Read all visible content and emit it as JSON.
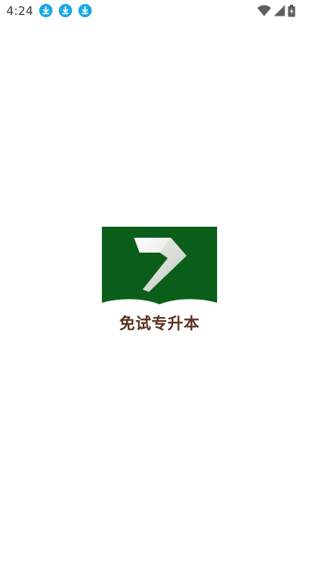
{
  "status_bar": {
    "time": "4:24",
    "notification_icons": [
      "download-icon",
      "download-icon",
      "download-icon"
    ],
    "system_icons": [
      "wifi-icon",
      "cell-signal-icon",
      "battery-charging-icon"
    ],
    "accent_color": "#1aa7e6"
  },
  "splash": {
    "logo_icon": "book-seven-logo",
    "app_name": "免试专升本",
    "logo_green": "#0b5e1a",
    "name_color": "#5b3320"
  }
}
